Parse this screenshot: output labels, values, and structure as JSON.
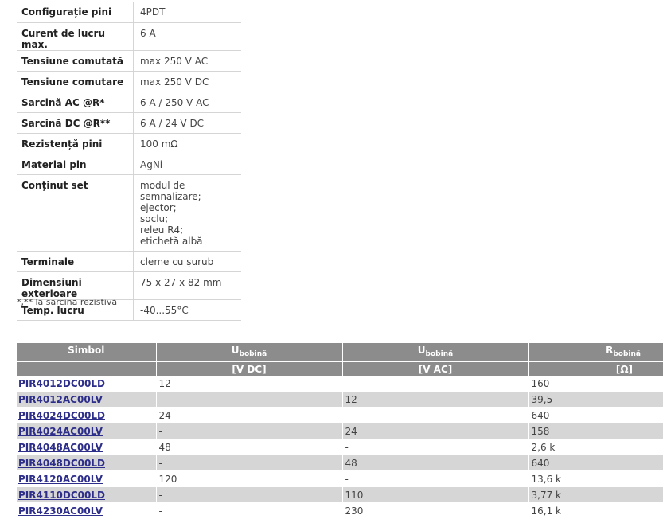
{
  "specs": [
    {
      "label": "Configurație pini",
      "value": [
        "4PDT"
      ]
    },
    {
      "label": "Curent de lucru max.",
      "value": [
        "6 A"
      ]
    },
    {
      "label": "Tensiune comutată",
      "value": [
        "max 250 V AC"
      ]
    },
    {
      "label": "Tensiune comutare",
      "value": [
        "max 250 V DC"
      ]
    },
    {
      "label": "Sarcină AC @R*",
      "value": [
        "6 A / 250 V AC"
      ]
    },
    {
      "label": "Sarcină DC @R**",
      "value": [
        "6 A / 24 V DC"
      ]
    },
    {
      "label": "Rezistență pini",
      "value": [
        "100 mΩ"
      ]
    },
    {
      "label": "Material pin",
      "value": [
        "AgNi"
      ]
    },
    {
      "label": "Conținut set",
      "value": [
        "modul de semnalizare;",
        "ejector;",
        "soclu;",
        "releu R4;",
        "etichetă albă"
      ]
    },
    {
      "label": "Terminale",
      "value": [
        "cleme cu șurub"
      ]
    },
    {
      "label": "Dimensiuni exterioare",
      "value": [
        "75 x 27 x 82 mm"
      ]
    },
    {
      "label": "Temp. lucru",
      "value": [
        "-40...55°C"
      ]
    }
  ],
  "footnote": "*,** la sarcina rezistivă",
  "products": {
    "headers": {
      "symbol": "Simbol",
      "u_main": "U",
      "u_sub": "bobină",
      "r_main": "R",
      "r_sub": "bobină",
      "unit_vdc": "[V DC]",
      "unit_vac": "[V AC]",
      "unit_ohm": "[Ω]"
    },
    "rows": [
      {
        "symbol": "PIR4012DC00LD",
        "vdc": "12",
        "vac": "-",
        "r": "160"
      },
      {
        "symbol": "PIR4012AC00LV",
        "vdc": "-",
        "vac": "12",
        "r": "39,5"
      },
      {
        "symbol": "PIR4024DC00LD",
        "vdc": "24",
        "vac": "-",
        "r": "640"
      },
      {
        "symbol": "PIR4024AC00LV",
        "vdc": "-",
        "vac": "24",
        "r": "158"
      },
      {
        "symbol": "PIR4048AC00LV",
        "vdc": "48",
        "vac": "-",
        "r": "2,6 k"
      },
      {
        "symbol": "PIR4048DC00LD",
        "vdc": "-",
        "vac": "48",
        "r": "640"
      },
      {
        "symbol": "PIR4120AC00LV",
        "vdc": "120",
        "vac": "-",
        "r": "13,6 k"
      },
      {
        "symbol": "PIR4110DC00LD",
        "vdc": "-",
        "vac": "110",
        "r": "3,77 k"
      },
      {
        "symbol": "PIR4230AC00LV",
        "vdc": "-",
        "vac": "230",
        "r": "16,1 k"
      }
    ]
  }
}
